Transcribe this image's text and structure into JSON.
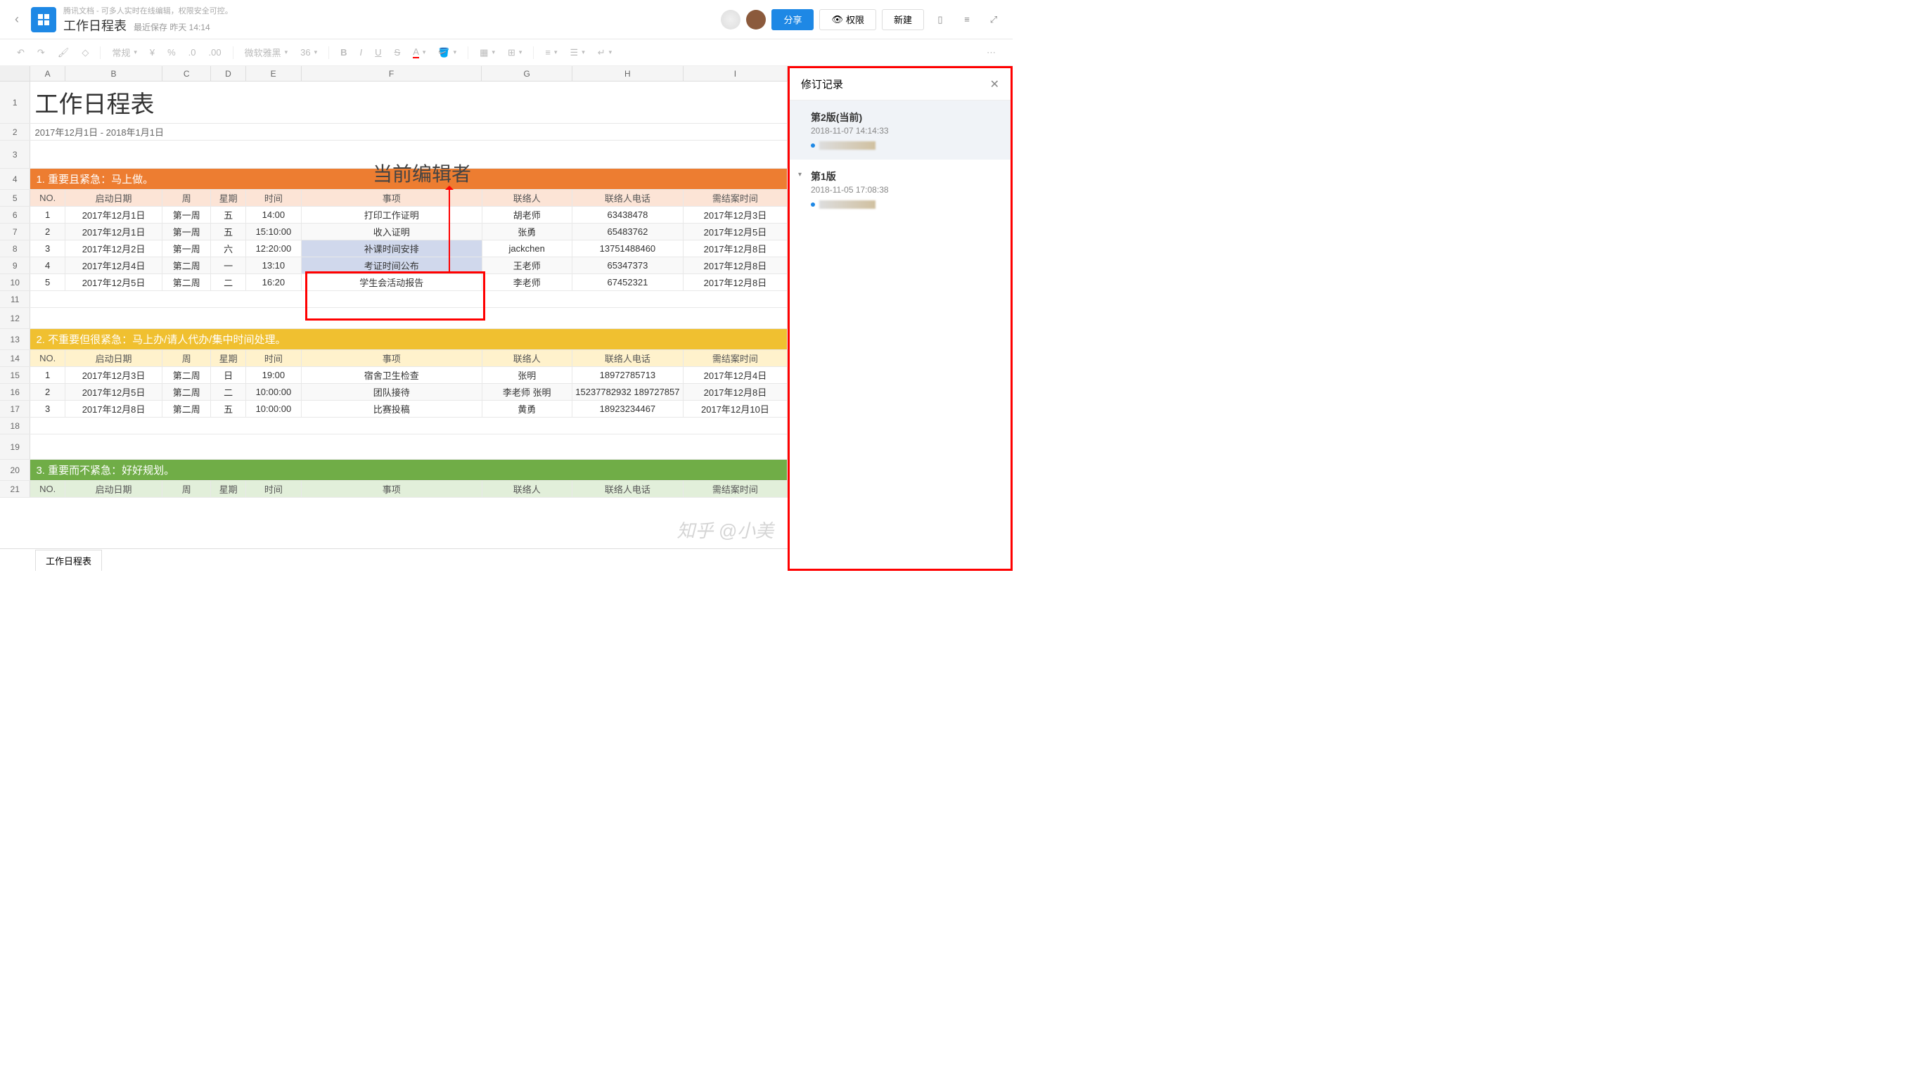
{
  "app": {
    "tagline": "腾讯文档 - 可多人实时在线编辑，权限安全可控。",
    "docTitle": "工作日程表",
    "saveInfo": "最近保存 昨天 14:14"
  },
  "topButtons": {
    "share": "分享",
    "perm": "权限",
    "new": "新建"
  },
  "toolbar": {
    "format": "常规",
    "font": "微软雅黑",
    "size": "36",
    "currency": "¥",
    "percent": "%",
    "decDown": ".0",
    "decUp": ".00"
  },
  "columns": [
    "A",
    "B",
    "C",
    "D",
    "E",
    "F",
    "G",
    "H",
    "I"
  ],
  "sheet": {
    "title": "工作日程表",
    "dateRange": "2017年12月1日 - 2018年1月1日",
    "section1": "1.  重要且紧急：马上做。",
    "section2": "2.  不重要但很紧急：马上办/请人代办/集中时间处理。",
    "section3": "3.  重要而不紧急：好好规划。",
    "headers": [
      "NO.",
      "启动日期",
      "周",
      "星期",
      "时间",
      "事项",
      "联络人",
      "联络人电话",
      "需结案时间"
    ],
    "rows1": [
      [
        "1",
        "2017年12月1日",
        "第一周",
        "五",
        "14:00",
        "打印工作证明",
        "胡老师",
        "63438478",
        "2017年12月3日"
      ],
      [
        "2",
        "2017年12月1日",
        "第一周",
        "五",
        "15:10:00",
        "收入证明",
        "张勇",
        "65483762",
        "2017年12月5日"
      ],
      [
        "3",
        "2017年12月2日",
        "第一周",
        "六",
        "12:20:00",
        "补课时间安排",
        "jackchen",
        "13751488460",
        "2017年12月8日"
      ],
      [
        "4",
        "2017年12月4日",
        "第二周",
        "一",
        "13:10",
        "考证时间公布",
        "王老师",
        "65347373",
        "2017年12月8日"
      ],
      [
        "5",
        "2017年12月5日",
        "第二周",
        "二",
        "16:20",
        "学生会活动报告",
        "李老师",
        "67452321",
        "2017年12月8日"
      ]
    ],
    "rows2": [
      [
        "1",
        "2017年12月3日",
        "第二周",
        "日",
        "19:00",
        "宿舍卫生检查",
        "张明",
        "18972785713",
        "2017年12月4日"
      ],
      [
        "2",
        "2017年12月5日",
        "第二周",
        "二",
        "10:00:00",
        "团队接待",
        "李老师 张明",
        "15237782932 189727857",
        "2017年12月8日"
      ],
      [
        "3",
        "2017年12月8日",
        "第二周",
        "五",
        "10:00:00",
        "比赛投稿",
        "黄勇",
        "18923234467",
        "2017年12月10日"
      ]
    ]
  },
  "annotation": "当前编辑者",
  "revision": {
    "title": "修订记录",
    "items": [
      {
        "version": "第2版(当前)",
        "date": "2018-11-07 14:14:33"
      },
      {
        "version": "第1版",
        "date": "2018-11-05 17:08:38"
      }
    ]
  },
  "footer": {
    "sheetTab": "工作日程表"
  },
  "watermark": "知乎 @小美"
}
